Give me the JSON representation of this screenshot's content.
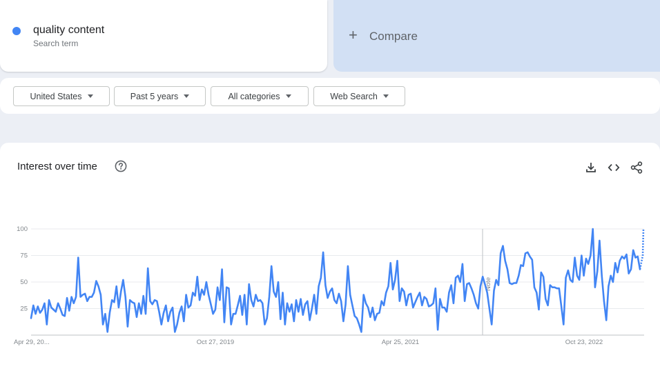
{
  "search_term": {
    "name": "quality content",
    "subtitle": "Search term",
    "color": "#4285f4"
  },
  "compare": {
    "label": "Compare",
    "icon": "plus-icon"
  },
  "filters": {
    "region": "United States",
    "time_range": "Past 5 years",
    "category": "All categories",
    "search_type": "Web Search"
  },
  "panel": {
    "title": "Interest over time",
    "icons": [
      "help-icon",
      "download-icon",
      "embed-code-icon",
      "share-icon"
    ]
  },
  "chart_data": {
    "type": "line",
    "title": "",
    "xlabel": "",
    "ylabel": "",
    "ylim": [
      0,
      100
    ],
    "y_ticks": [
      25,
      50,
      75,
      100
    ],
    "x_tick_labels": [
      "Apr 29, 20...",
      "Oct 27, 2019",
      "Apr 25, 2021",
      "Oct 23, 2022"
    ],
    "annotation": "Note",
    "grid": true,
    "series": [
      {
        "color": "#4285f4",
        "values": [
          16,
          28,
          20,
          27,
          21,
          24,
          30,
          10,
          33,
          26,
          24,
          22,
          30,
          25,
          19,
          18,
          35,
          23,
          36,
          30,
          36,
          73,
          36,
          38,
          39,
          32,
          36,
          36,
          40,
          51,
          46,
          38,
          10,
          20,
          3,
          21,
          33,
          31,
          46,
          26,
          41,
          52,
          36,
          8,
          33,
          31,
          30,
          17,
          30,
          20,
          37,
          20,
          63,
          32,
          29,
          33,
          32,
          22,
          10,
          21,
          28,
          13,
          22,
          26,
          3,
          10,
          21,
          27,
          13,
          38,
          26,
          28,
          40,
          37,
          55,
          33,
          43,
          38,
          50,
          38,
          29,
          20,
          24,
          45,
          33,
          62,
          12,
          45,
          44,
          10,
          20,
          20,
          28,
          37,
          19,
          38,
          10,
          48,
          33,
          27,
          38,
          32,
          33,
          30,
          10,
          16,
          36,
          65,
          41,
          36,
          50,
          15,
          40,
          10,
          30,
          22,
          29,
          13,
          33,
          22,
          34,
          19,
          29,
          32,
          14,
          25,
          38,
          20,
          46,
          54,
          78,
          47,
          35,
          41,
          44,
          33,
          30,
          39,
          32,
          13,
          29,
          65,
          38,
          28,
          18,
          16,
          10,
          3,
          38,
          30,
          26,
          17,
          26,
          14,
          20,
          21,
          32,
          28,
          40,
          46,
          68,
          43,
          52,
          70,
          32,
          44,
          41,
          28,
          38,
          39,
          26,
          31,
          36,
          40,
          28,
          36,
          34,
          27,
          28,
          30,
          44,
          5,
          34,
          26,
          26,
          22,
          40,
          47,
          30,
          54,
          56,
          50,
          67,
          32,
          48,
          49,
          44,
          38,
          30,
          25,
          46,
          55,
          48,
          40,
          25,
          10,
          42,
          52,
          47,
          77,
          84,
          70,
          62,
          49,
          48,
          49,
          49,
          56,
          66,
          65,
          77,
          78,
          74,
          71,
          45,
          40,
          24,
          59,
          55,
          34,
          28,
          47,
          45,
          45,
          44,
          44,
          27,
          10,
          54,
          61,
          52,
          50,
          73,
          56,
          52,
          75,
          56,
          72,
          67,
          75,
          100,
          45,
          60,
          89,
          56,
          32,
          14,
          46,
          56,
          50,
          68,
          59,
          70,
          74,
          72,
          76,
          58,
          62,
          80,
          73,
          74,
          62
        ]
      }
    ],
    "partial_tail": [
      62,
      75,
      100
    ]
  }
}
